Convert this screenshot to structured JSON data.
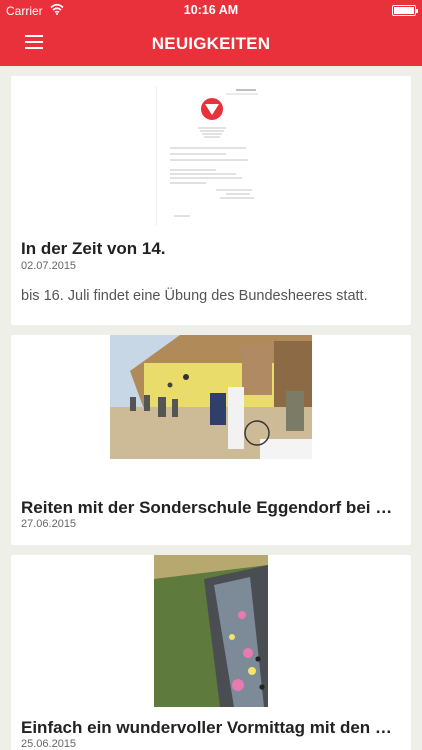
{
  "status_bar": {
    "carrier": "Carrier",
    "time": "10:16 AM"
  },
  "nav": {
    "title": "NEUIGKEITEN",
    "menu_icon": "hamburger-menu-icon"
  },
  "colors": {
    "accent": "#e8313a",
    "background": "#efefe9",
    "card": "#ffffff"
  },
  "articles": [
    {
      "title": "In der Zeit von 14.",
      "date": "02.07.2015",
      "teaser": "bis 16. Juli findet eine Übung des Bundesheeres statt."
    },
    {
      "title": "Reiten mit der Sonderschule Eggendorf bei d…",
      "date": "27.06.2015"
    },
    {
      "title": "Einfach ein wundervoller Vormittag mit den K…",
      "date": "25.06.2015"
    }
  ]
}
